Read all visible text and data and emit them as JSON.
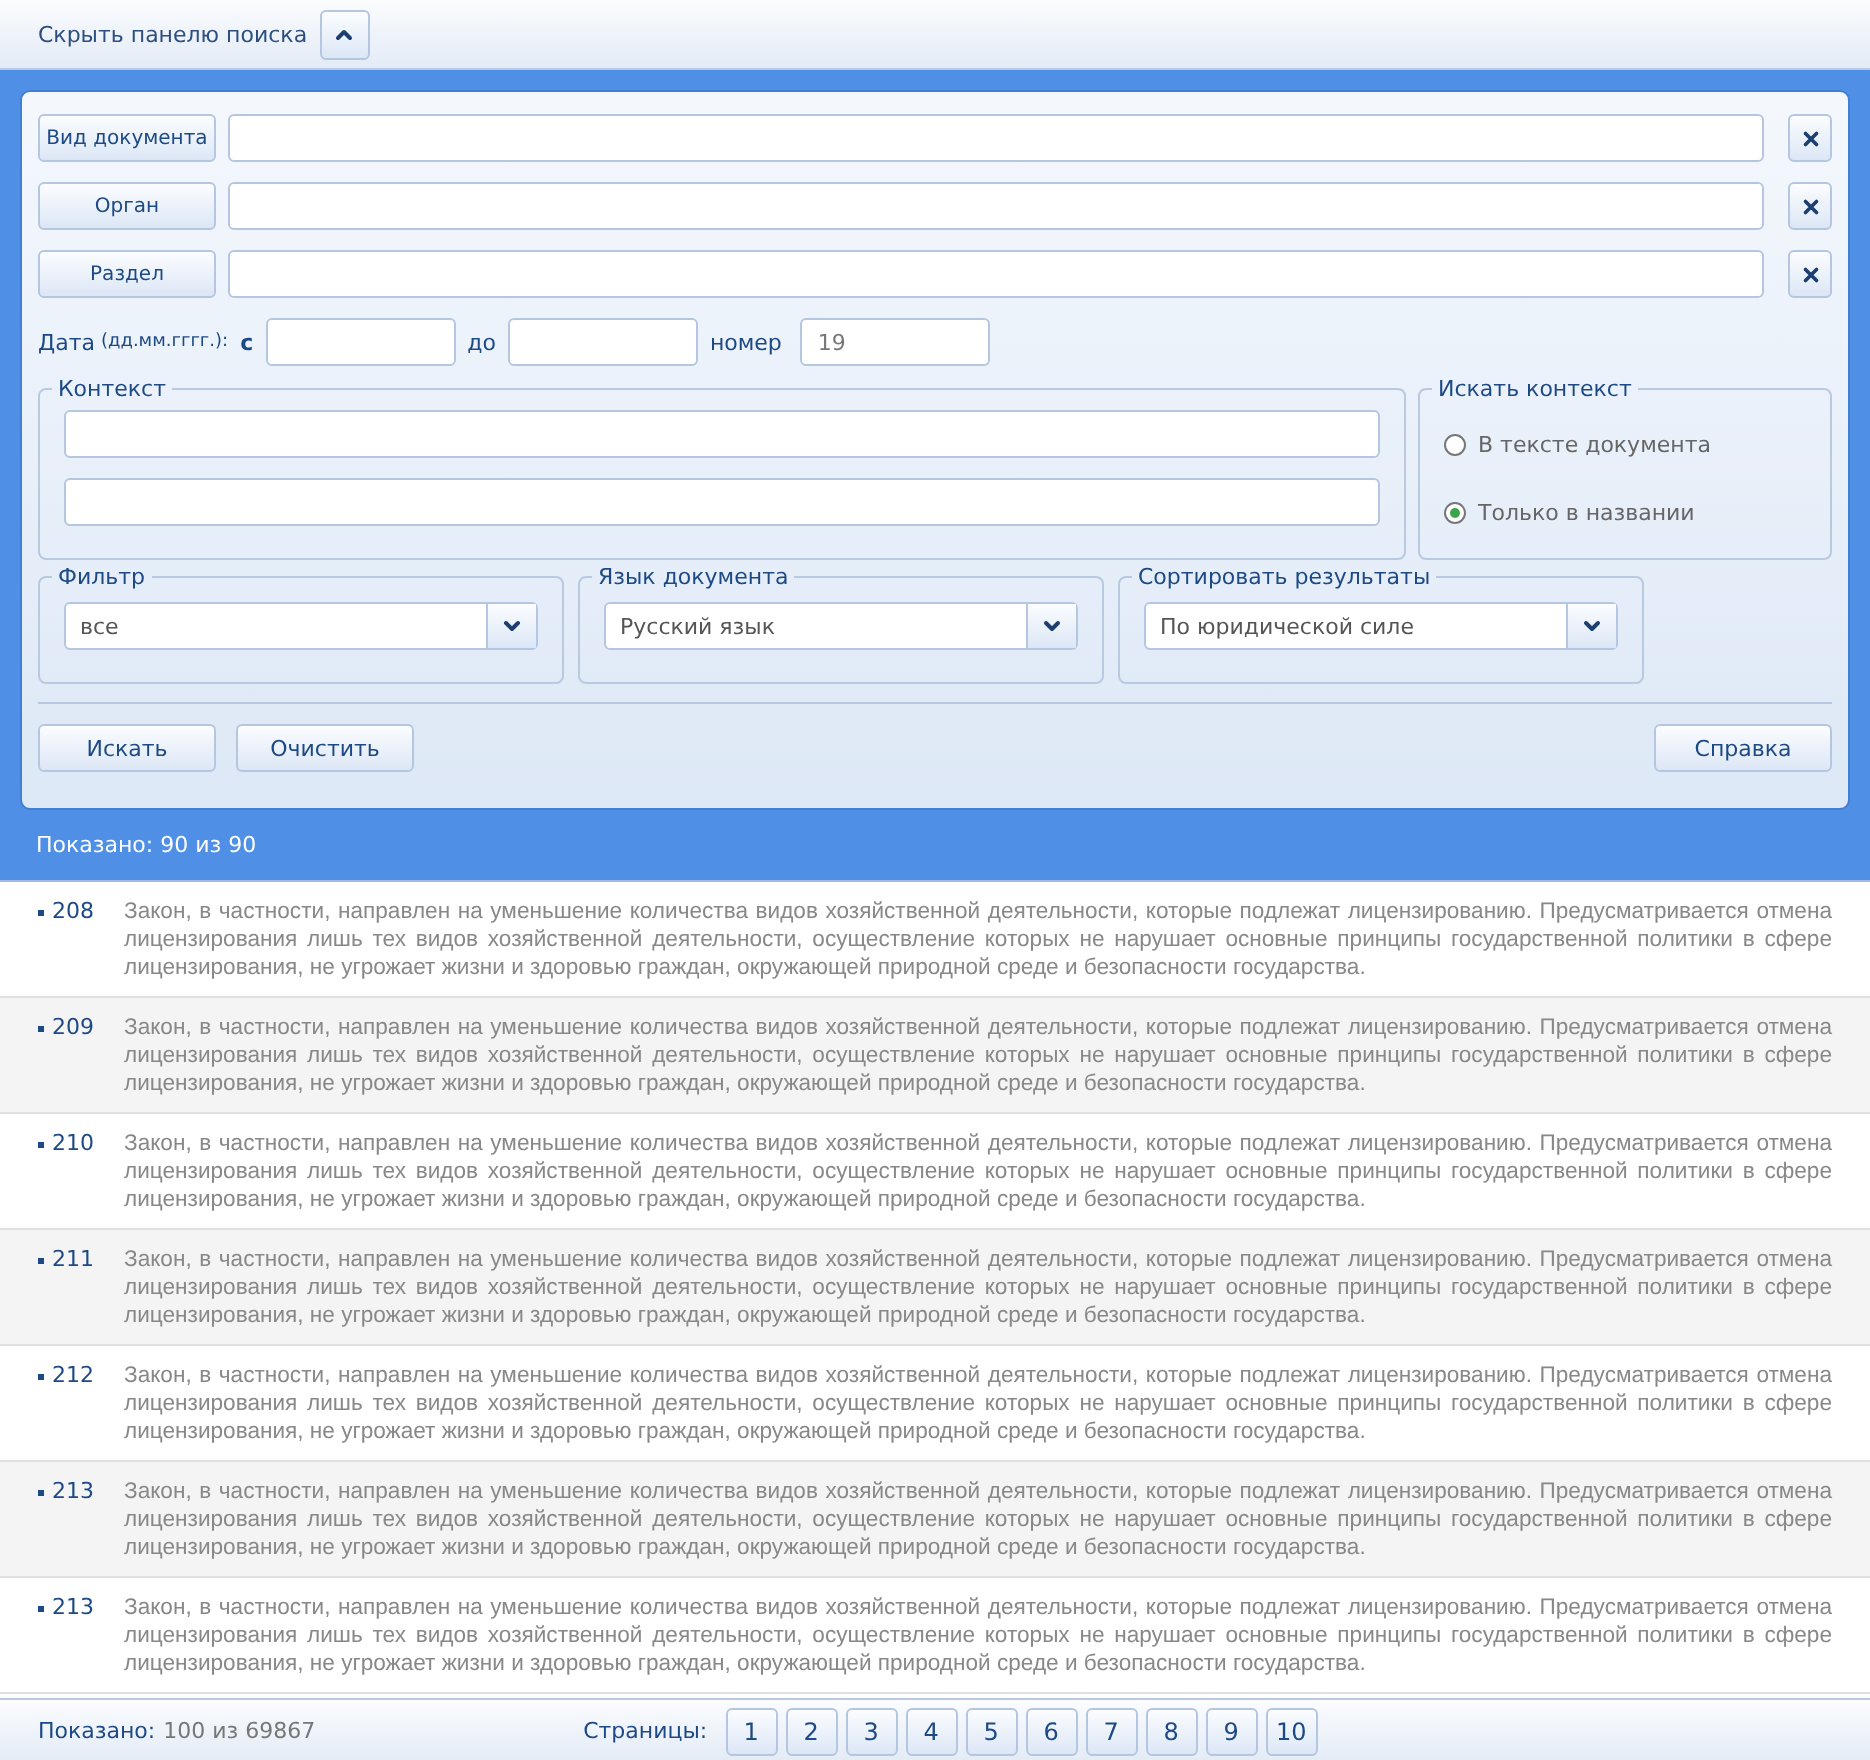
{
  "toggle": {
    "label": "Скрыть панелю поиска"
  },
  "lookups": [
    {
      "button": "Вид документа"
    },
    {
      "button": "Орган"
    },
    {
      "button": "Раздел"
    }
  ],
  "date": {
    "label": "Дата",
    "hint": "(дд.мм.гггг.):",
    "from_label": "с",
    "to_label": "до",
    "number_label": "номер",
    "number_value": "19"
  },
  "context": {
    "legend": "Контекст"
  },
  "search_in": {
    "legend": "Искать контекст",
    "options": [
      {
        "label": "В тексте документа",
        "selected": false
      },
      {
        "label": "Только в названии",
        "selected": true
      }
    ]
  },
  "dropdowns": [
    {
      "legend": "Фильтр",
      "value": "все"
    },
    {
      "legend": "Язык документа",
      "value": "Русский язык"
    },
    {
      "legend": "Сортировать результаты",
      "value": "По юридической силе"
    }
  ],
  "actions": {
    "left": [
      "Искать",
      "Очистить"
    ],
    "right": [
      "Справка"
    ]
  },
  "shown_top": "Показано: 90 из 90",
  "results": [
    {
      "number": "208",
      "text": "Закон, в частности, направлен на уменьшение количества видов хозяйственной деятельности, которые подлежат лицензированию. Предусматривается отмена лицензирования лишь тех видов хозяйственной деятельности, осуществление которых не нарушает основные принципы государственной политики в сфере лицензирования, не угрожает жизни и здоровью граждан, окружающей природной среде и безопасности государства."
    },
    {
      "number": "209",
      "text": "Закон, в частности, направлен на уменьшение количества видов хозяйственной деятельности, которые подлежат лицензированию. Предусматривается отмена лицензирования лишь тех видов хозяйственной деятельности, осуществление которых не нарушает основные принципы государственной политики в сфере лицензирования, не угрожает жизни и здоровью граждан, окружающей природной среде и безопасности государства."
    },
    {
      "number": "210",
      "text": "Закон, в частности, направлен на уменьшение количества видов хозяйственной деятельности, которые подлежат лицензированию. Предусматривается отмена лицензирования лишь тех видов хозяйственной деятельности, осуществление которых не нарушает основные принципы государственной политики в сфере лицензирования, не угрожает жизни и здоровью граждан, окружающей природной среде и безопасности государства."
    },
    {
      "number": "211",
      "text": "Закон, в частности, направлен на уменьшение количества видов хозяйственной деятельности, которые подлежат лицензированию. Предусматривается отмена лицензирования лишь тех видов хозяйственной деятельности, осуществление которых не нарушает основные принципы государственной политики в сфере лицензирования, не угрожает жизни и здоровью граждан, окружающей природной среде и безопасности государства."
    },
    {
      "number": "212",
      "text": "Закон, в частности, направлен на уменьшение количества видов хозяйственной деятельности, которые подлежат лицензированию. Предусматривается отмена лицензирования лишь тех видов хозяйственной деятельности, осуществление которых не нарушает основные принципы государственной политики в сфере лицензирования, не угрожает жизни и здоровью граждан, окружающей природной среде и безопасности государства."
    },
    {
      "number": "213",
      "text": "Закон, в частности, направлен на уменьшение количества видов хозяйственной деятельности, которые подлежат лицензированию. Предусматривается отмена лицензирования лишь тех видов хозяйственной деятельности, осуществление которых не нарушает основные принципы государственной политики в сфере лицензирования, не угрожает жизни и здоровью граждан, окружающей природной среде и безопасности государства."
    },
    {
      "number": "213",
      "text": "Закон, в частности, направлен на уменьшение количества видов хозяйственной деятельности, которые подлежат лицензированию. Предусматривается отмена лицензирования лишь тех видов хозяйственной деятельности, осуществление которых не нарушает основные принципы государственной политики в сфере лицензирования, не угрожает жизни и здоровью граждан, окружающей природной среде и безопасности государства."
    }
  ],
  "footer": {
    "shown_label": "Показано:",
    "shown_value": "100 из 69867",
    "pages_label": "Страницы:",
    "pages": [
      "1",
      "2",
      "3",
      "4",
      "5",
      "6",
      "7",
      "8",
      "9",
      "10"
    ]
  }
}
